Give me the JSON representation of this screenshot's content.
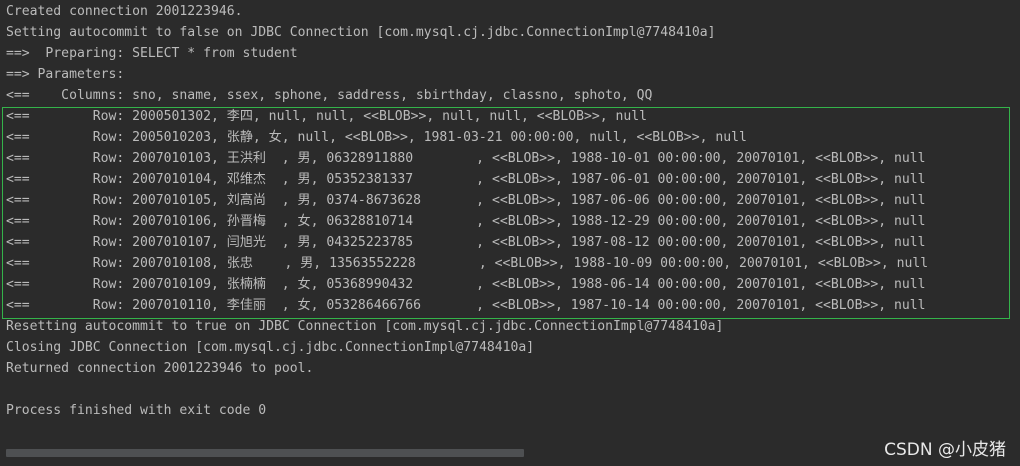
{
  "console": {
    "lines": [
      "Created connection 2001223946.",
      "Setting autocommit to false on JDBC Connection [com.mysql.cj.jdbc.ConnectionImpl@7748410a]",
      "==>  Preparing: SELECT * from student",
      "==> Parameters: ",
      "<==    Columns: sno, sname, ssex, sphone, saddress, sbirthday, classno, sphoto, QQ",
      "<==        Row: 2000501302, 李四, null, null, <<BLOB>>, null, null, <<BLOB>>, null",
      "<==        Row: 2005010203, 张静, 女, null, <<BLOB>>, 1981-03-21 00:00:00, null, <<BLOB>>, null",
      "<==        Row: 2007010103, 王洪利  , 男, 06328911880        , <<BLOB>>, 1988-10-01 00:00:00, 20070101, <<BLOB>>, null",
      "<==        Row: 2007010104, 邓维杰  , 男, 05352381337        , <<BLOB>>, 1987-06-01 00:00:00, 20070101, <<BLOB>>, null",
      "<==        Row: 2007010105, 刘高尚  , 男, 0374-8673628       , <<BLOB>>, 1987-06-06 00:00:00, 20070101, <<BLOB>>, null",
      "<==        Row: 2007010106, 孙晋梅  , 女, 06328810714        , <<BLOB>>, 1988-12-29 00:00:00, 20070101, <<BLOB>>, null",
      "<==        Row: 2007010107, 闫旭光  , 男, 04325223785        , <<BLOB>>, 1987-08-12 00:00:00, 20070101, <<BLOB>>, null",
      "<==        Row: 2007010108, 张忠    , 男, 13563552228        , <<BLOB>>, 1988-10-09 00:00:00, 20070101, <<BLOB>>, null",
      "<==        Row: 2007010109, 张楠楠  , 女, 05368990432        , <<BLOB>>, 1988-06-14 00:00:00, 20070101, <<BLOB>>, null",
      "<==        Row: 2007010110, 李佳丽  , 女, 053286466766       , <<BLOB>>, 1987-10-14 00:00:00, 20070101, <<BLOB>>, null",
      "Resetting autocommit to true on JDBC Connection [com.mysql.cj.jdbc.ConnectionImpl@7748410a]",
      "Closing JDBC Connection [com.mysql.cj.jdbc.ConnectionImpl@7748410a]",
      "Returned connection 2001223946 to pool.",
      "",
      "Process finished with exit code 0"
    ]
  },
  "watermark": "CSDN @小皮猪",
  "colors": {
    "background": "#2b2b2b",
    "text": "#bbbbbb",
    "highlight_border": "#34b34a"
  }
}
